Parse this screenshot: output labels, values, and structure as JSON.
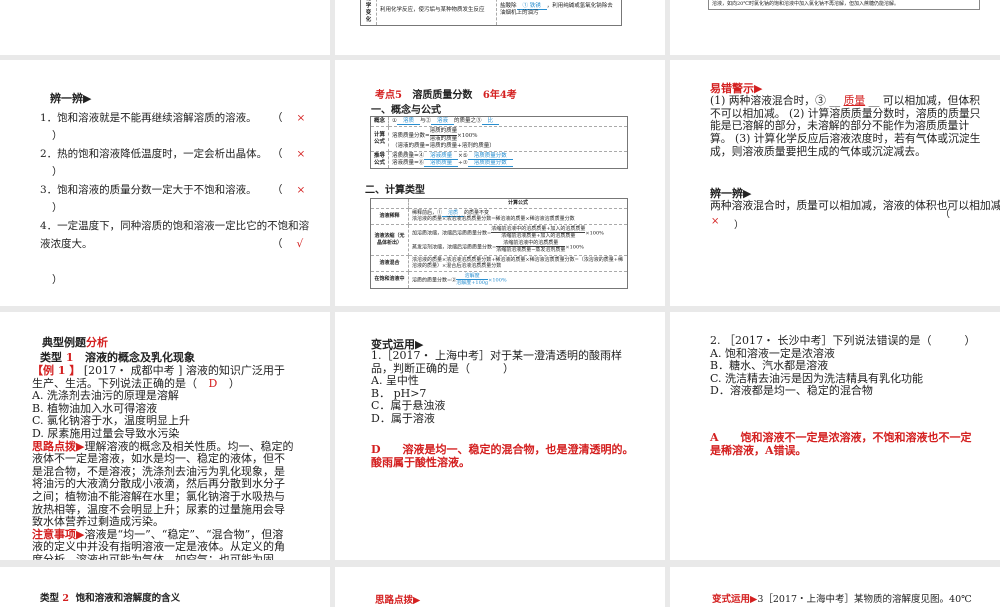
{
  "top": {
    "mid_row_head": "化学变化",
    "mid_row_c1": "利用化学反应，使污垢与某种物质发生反应",
    "mid_row_c2a": "盐酸除",
    "mid_row_blank": "① 铁锈",
    "mid_row_c2b": "，利用纯碱或氢氧化钠除去油烟机上的油污",
    "right_box": "溶液，如向20℃时氯化钠的饱和溶液中加入氯化钠不再溶解，但加入蔗糖仍能溶解。"
  },
  "s1": {
    "heading": "辨一辨▶",
    "items": [
      {
        "text": "1．饱和溶液就是不能再继续溶解溶质的溶液。",
        "open": "（",
        "mark": "×",
        "close": "）"
      },
      {
        "text": "2．热的饱和溶液降低温度时，一定会析出晶体。",
        "open": "（",
        "mark": "×",
        "close": "）"
      },
      {
        "text": "3．饱和溶液的质量分数一定大于不饱和溶液。",
        "open": "（",
        "mark": "×",
        "close": "）"
      },
      {
        "text": "4．一定温度下，同种溶质的饱和溶液一定比它的不饱和溶液浓度大。",
        "open": "（",
        "mark": "√",
        "close": "）"
      }
    ]
  },
  "s2": {
    "kd": "考点5",
    "topic": "溶质质量分数",
    "freq": "6年4考",
    "sec1": "一、概念与公式",
    "sec2": "二、计算类型",
    "t1": {
      "r1h": "概念",
      "r1": [
        "①",
        "溶质",
        "与②",
        "溶液",
        "的质量之③",
        "比"
      ],
      "r2h": "计算公式",
      "r2a": "溶质质量分数=",
      "r2num": "溶质的质量",
      "r2den": "溶液的质量",
      "r2b": "×100%",
      "r2c": "（溶液的质量=溶质的质量+溶剂的质量）",
      "r3h": "推导公式",
      "r3a": "溶质质量=④",
      "r3ab": "溶液质量",
      "r3ac": "×⑤",
      "r3ad": "溶质质量分数",
      "r3b": "溶液质量=⑥",
      "r3bb": "溶质质量",
      "r3bc": "÷⑦",
      "r3bd": "溶质质量分数"
    },
    "t2": {
      "head": "计算公式",
      "rows": [
        {
          "h": "溶液稀释",
          "l1a": "稀释前后，①",
          "l1b": "溶质",
          "l1c": "的质量不变",
          "l2": "浓溶液的质量×浓溶液溶质质量分数=稀溶液的质量×稀溶液溶质质量分数"
        },
        {
          "h": "溶液浓缩（无晶体析出）",
          "l1": "加溶质浓缩，浓缩后溶质质量分数=",
          "n1": "浓缩前溶液中的溶质质量+加入的溶质质量",
          "d1": "浓缩前溶液质量+加入的溶质质量",
          "p1": "×100%",
          "l2": "蒸发溶剂浓缩，浓缩后溶质质量分数=",
          "n2": "浓缩前溶液中的溶质质量",
          "d2": "浓缩前溶液质量−蒸发溶剂质量",
          "p2": "×100%"
        },
        {
          "h": "溶液混合",
          "l1": "浓溶液的质量×浓溶液溶质质量分数+稀溶液的质量×稀溶液溶质质量分数=（浓溶液的质量+稀溶液的质量）×混合后溶液溶质质量分数"
        },
        {
          "h": "在饱和溶液中",
          "l1": "溶质的质量分数=②",
          "n": "溶解度",
          "d": "溶解度+100g",
          "p": "×100%"
        }
      ]
    }
  },
  "s3": {
    "warn": "易错警示▶",
    "p1": "(1) 两种溶液混合时，③ __ ",
    "blank": "质量",
    "p2": " __ 可以相加减，但体积不可以相加减。 (2) 计算溶质质量分数时，溶质的质量只能是已溶解的部分，未溶解的部分不能作为溶质质量计算。 (3) 计算化学反应后溶液浓度时，若有气体或沉淀生成，则溶液质量要把生成的气体或沉淀减去。",
    "heading": "辨一辨▶",
    "q": "两种溶液混合时，质量可以相加减，溶液的体积也可以相加减。",
    "open": "（",
    "mark": "×",
    "close": "）"
  },
  "s4": {
    "title_a": "典型例题",
    "title_b": "分析",
    "type_label": "类型",
    "type_num": "1",
    "type_title": "溶液的概念及乳化现象",
    "ex_label": "【例 1 】",
    "ex_q": " [2017・ 成都中考 ] 溶液的知识广泛用于生产、生活。下列说法正确的是（ ",
    "ex_ans": "D",
    "ex_close": " ）",
    "options": [
      "A. 洗涤剂去油污的原理是溶解",
      "B. 植物油加入水可得溶液",
      "C. 氯化钠溶于水，温度明显上升",
      "D. 尿素施用过量会导致水污染"
    ],
    "hint_label": "思路点拨▶",
    "hint": "理解溶液的概念及相关性质。均一、稳定的液体不一定是溶液，如水是均一、稳定的液体，但不是混合物，不是溶液；洗涤剂去油污为乳化现象，是将油污的大液滴分散成小液滴，然后再分散到水分子之间；植物油不能溶解在水里；氯化钠溶于水吸热与放热相等，温度不会明显上升；尿素的过量施用会导致水体营养过剩造成污染。",
    "note_label": "注意事项▶",
    "note": "溶液是“均一”、“稳定”、“混合物”，但溶液的定义中并没有指明溶液一定是液体。从定义的角度分析，溶液也可能为气体，如空气；也可能为固体。"
  },
  "s5": {
    "heading": "变式运用▶",
    "q": "1.［2017・ 上海中考］对于某一澄清透明的酸雨样品，判断正确的是（　　　）",
    "options": [
      "A. 呈中性",
      "B． pH>7",
      "C．属于悬浊液",
      "D．属于溶液"
    ],
    "ans": "D　　溶液是均一、稳定的混合物，也是澄清透明的。酸雨属于酸性溶液。"
  },
  "s6": {
    "q": "2. ［2017・ 长沙中考］下列说法错误的是（　　　）",
    "options": [
      "A. 饱和溶液一定是浓溶液",
      "B．糖水、汽水都是溶液",
      "C. 洗洁精去油污是因为洗洁精具有乳化功能",
      "D．溶液都是均一、稳定的混合物"
    ],
    "ans": "A　　饱和溶液不一定是浓溶液，不饱和溶液也不一定是稀溶液，A错误。"
  },
  "bottom": {
    "type_label": "类型",
    "type_num": "2",
    "type_title": "饱和溶液和溶解度的含义",
    "hint_label": "思路点拨▶",
    "var_label": "变式运用▶",
    "var_q": "3［2017・上海中考］某物质的溶解度见图。40℃"
  }
}
